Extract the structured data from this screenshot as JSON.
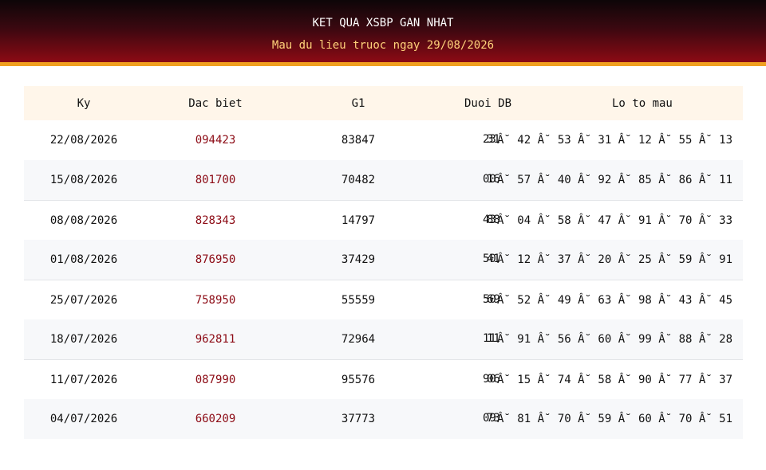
{
  "header": {
    "title": "KET QUA XSBP GAN NHAT",
    "subtitle": "Mau du lieu truoc ngay 29/08/2026"
  },
  "table": {
    "columns": [
      "Ky",
      "Dac biet",
      "G1",
      "Duoi DB",
      "Lo to mau"
    ],
    "rows": [
      {
        "ky": "22/08/2026",
        "dac_biet": "094423",
        "g1": "83847",
        "duoi_a": "23",
        "duoi_b": "31",
        "lo_to": "Â˘ 42 Â˘ 53 Â˘ 31 Â˘ 12 Â˘ 55 Â˘ 13"
      },
      {
        "ky": "15/08/2026",
        "dac_biet": "801700",
        "g1": "70482",
        "duoi_a": "00",
        "duoi_b": "16",
        "lo_to": "Â˘ 57 Â˘ 40 Â˘ 92 Â˘ 85 Â˘ 86 Â˘ 11"
      },
      {
        "ky": "08/08/2026",
        "dac_biet": "828343",
        "g1": "14797",
        "duoi_a": "43",
        "duoi_b": "88",
        "lo_to": "Â˘ 04 Â˘ 58 Â˘ 47 Â˘ 91 Â˘ 70 Â˘ 33"
      },
      {
        "ky": "01/08/2026",
        "dac_biet": "876950",
        "g1": "37429",
        "duoi_a": "50",
        "duoi_b": "41",
        "lo_to": "Â˘ 12 Â˘ 37 Â˘ 20 Â˘ 25 Â˘ 59 Â˘ 91"
      },
      {
        "ky": "25/07/2026",
        "dac_biet": "758950",
        "g1": "55559",
        "duoi_a": "50",
        "duoi_b": "69",
        "lo_to": "Â˘ 52 Â˘ 49 Â˘ 63 Â˘ 98 Â˘ 43 Â˘ 45"
      },
      {
        "ky": "18/07/2026",
        "dac_biet": "962811",
        "g1": "72964",
        "duoi_a": "11",
        "duoi_b": "11",
        "lo_to": "Â˘ 91 Â˘ 56 Â˘ 60 Â˘ 99 Â˘ 88 Â˘ 28"
      },
      {
        "ky": "11/07/2026",
        "dac_biet": "087990",
        "g1": "95576",
        "duoi_a": "90",
        "duoi_b": "06",
        "lo_to": "Â˘ 15 Â˘ 74 Â˘ 58 Â˘ 90 Â˘ 77 Â˘ 37"
      },
      {
        "ky": "04/07/2026",
        "dac_biet": "660209",
        "g1": "37773",
        "duoi_a": "09",
        "duoi_b": "73",
        "lo_to": "Â˘ 81 Â˘ 70 Â˘ 59 Â˘ 60 Â˘ 70 Â˘ 51"
      }
    ]
  }
}
